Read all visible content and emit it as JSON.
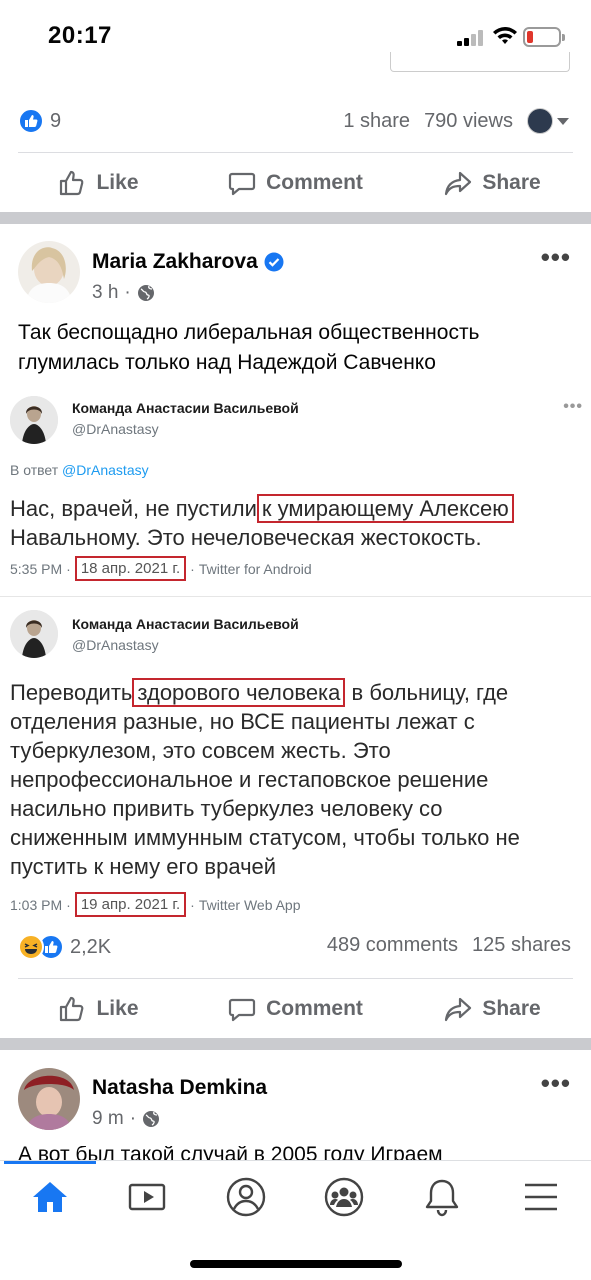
{
  "status_bar": {
    "time": "20:17",
    "battery_color": "#e0362c"
  },
  "post1": {
    "reaction_count": "9",
    "shares": "1 share",
    "views": "790 views"
  },
  "actions": {
    "like": "Like",
    "comment": "Comment",
    "share": "Share"
  },
  "post2": {
    "author": "Maria Zakharova",
    "verified": true,
    "time": "3 h",
    "visibility_icon": "globe-icon",
    "text_line1": "Так беспощадно либеральная общественность",
    "text_line2": "глумилась только  над Надеждой Савченко",
    "tweet1": {
      "name": "Команда Анастасии Васильевой",
      "handle": "@DrAnastasy",
      "reply_prefix": "В ответ",
      "reply_handle": "@DrAnastasy",
      "body_before": "Нас, врачей, не пустили",
      "body_boxed": "к умирающему Алексею",
      "body_after": "Навальному. Это нечеловеческая жестокость.",
      "time": "5:35 PM",
      "date": "18 апр. 2021 г.",
      "source": "Twitter for Android"
    },
    "tweet2": {
      "name": "Команда Анастасии Васильевой",
      "handle": "@DrAnastasy",
      "body_before": "Переводить",
      "body_boxed": "здорового человека",
      "body_after1": "в больницу, где",
      "body_line2": "отделения разные, но ВСЕ пациенты лежат с",
      "body_line3": "туберкулезом, это совсем жесть. Это",
      "body_line4": "непрофессиональное и гестаповское решение",
      "body_line5": "насильно привить туберкулез человеку со",
      "body_line6": "сниженным иммунным статусом, чтобы только не",
      "body_line7": "пустить к нему его врачей",
      "time": "1:03 PM",
      "date": "19 апр. 2021 г.",
      "source": "Twitter Web App"
    },
    "reaction_count": "2,2K",
    "comments": "489 comments",
    "shares": "125 shares"
  },
  "post3": {
    "author": "Natasha Demkina",
    "time": "9 m",
    "text_partial": "А вот был такой случай в 2005 году  Играем"
  },
  "nav": {
    "items": [
      "home-icon",
      "video-icon",
      "profile-icon",
      "groups-icon",
      "notifications-icon",
      "menu-icon"
    ],
    "active_color": "#1877f2"
  }
}
